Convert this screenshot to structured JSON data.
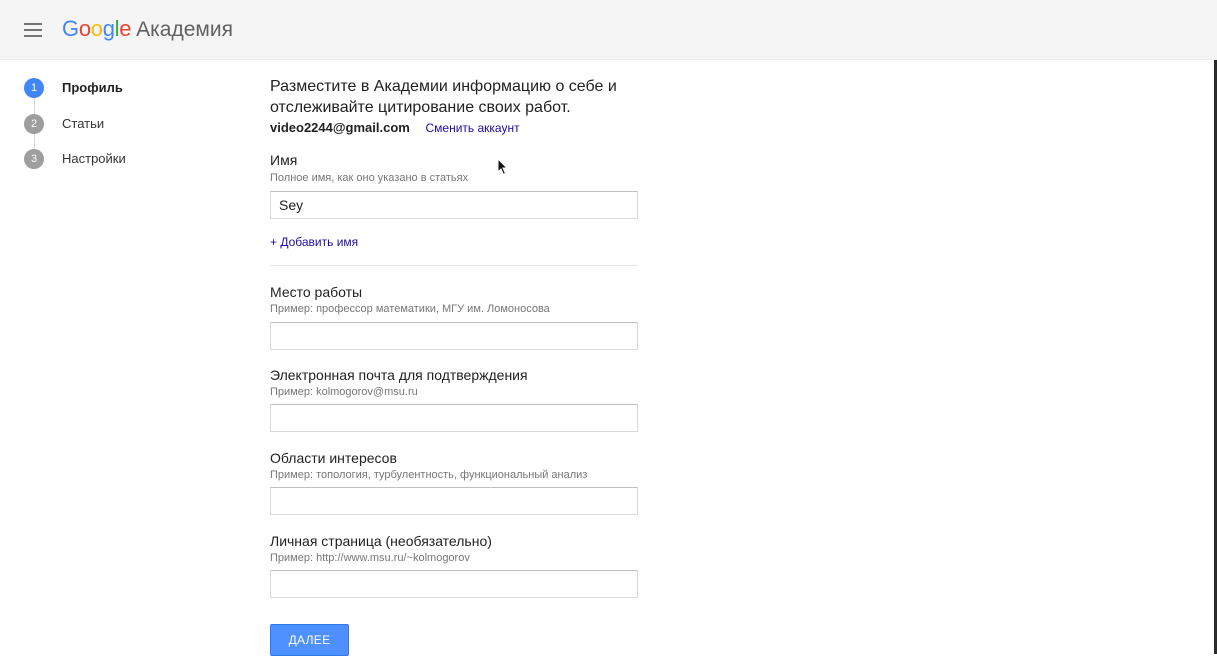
{
  "header": {
    "logo": {
      "G": "G",
      "o1": "o",
      "o2": "o",
      "g": "g",
      "l": "l",
      "e": "e"
    },
    "product": "Академия",
    "menu_icon": "hamburger-menu-icon"
  },
  "steps": [
    {
      "number": "1",
      "label": "Профиль",
      "active": true
    },
    {
      "number": "2",
      "label": "Статьи",
      "active": false
    },
    {
      "number": "3",
      "label": "Настройки",
      "active": false
    }
  ],
  "intro": "Разместите в Академии информацию о себе и отслеживайте цитирование своих работ.",
  "account": {
    "email": "video2244@gmail.com",
    "switch_label": "Сменить аккаунт"
  },
  "fields": {
    "name": {
      "label": "Имя",
      "hint": "Полное имя, как оно указано в статьях",
      "value": "Sey"
    },
    "add_name": "+ Добавить имя",
    "affiliation": {
      "label": "Место работы",
      "hint": "Пример: профессор математики, МГУ им. Ломоносова",
      "value": ""
    },
    "email": {
      "label": "Электронная почта для подтверждения",
      "hint": "Пример: kolmogorov@msu.ru",
      "value": ""
    },
    "interests": {
      "label": "Области интересов",
      "hint": "Пример: топология, турбулентность, функциональный анализ",
      "value": ""
    },
    "homepage": {
      "label": "Личная страница (необязательно)",
      "hint": "Пример: http://www.msu.ru/~kolmogorov",
      "value": ""
    }
  },
  "next_button": "ДАЛЕЕ",
  "colors": {
    "primary_blue": "#4285f4",
    "button_blue": "#4d90fe",
    "link": "#1a0dab"
  }
}
